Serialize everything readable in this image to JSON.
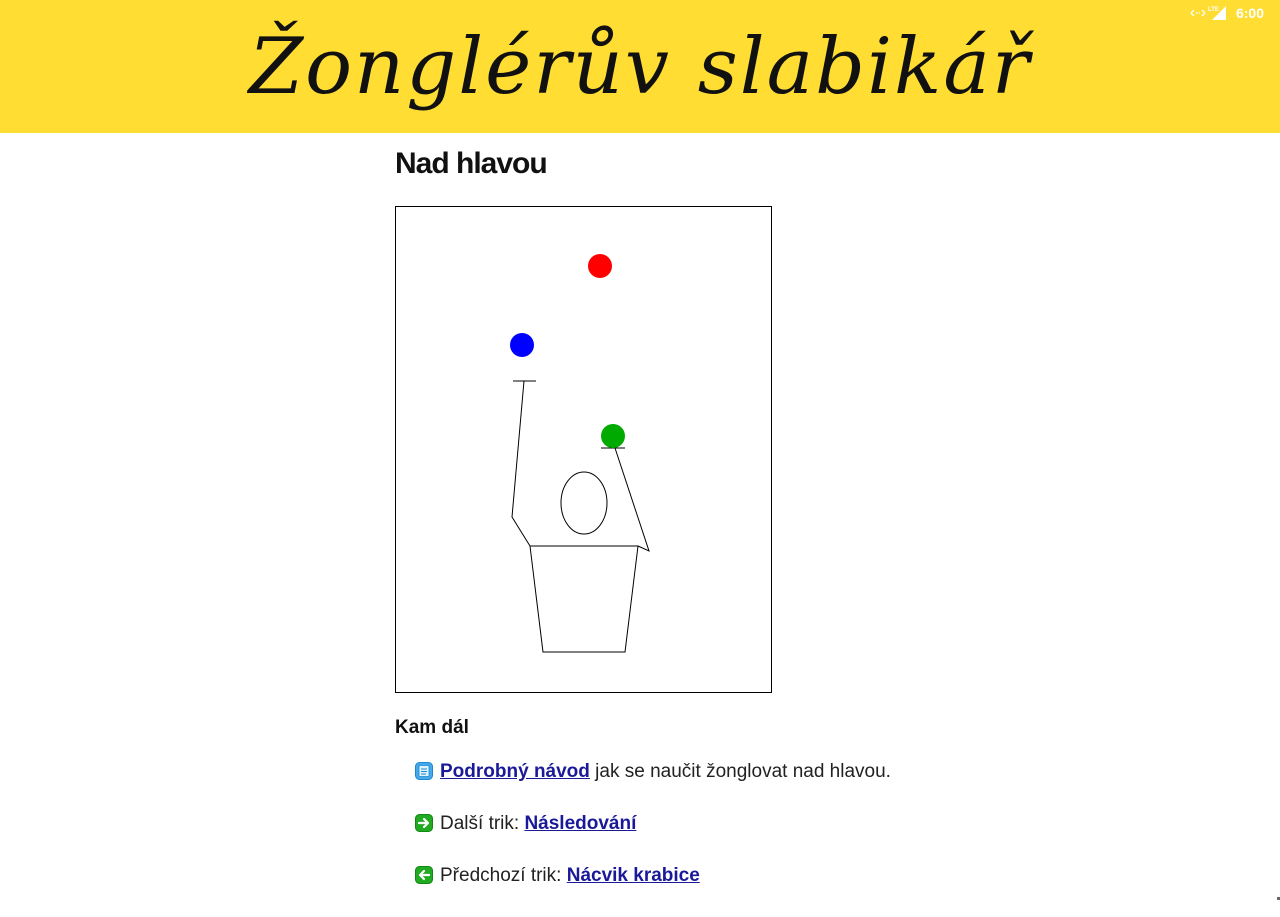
{
  "status_bar": {
    "time": "6:00",
    "icons": [
      "data-sync-icon",
      "lte-signal-icon"
    ],
    "color": "#ffffff"
  },
  "header": {
    "site_title": "Žonglérův slabikář",
    "background": "#ffdd33"
  },
  "page": {
    "title": "Nad hlavou"
  },
  "figure": {
    "balls": [
      {
        "name": "red-ball",
        "color": "#ff0000"
      },
      {
        "name": "blue-ball",
        "color": "#0000ff"
      },
      {
        "name": "green-ball",
        "color": "#00aa00"
      }
    ]
  },
  "next_steps": {
    "heading": "Kam dál",
    "items": [
      {
        "icon": "document-icon",
        "link_text": "Podrobný návod",
        "prefix": "",
        "suffix": " jak se naučit žonglovat nad hlavou."
      },
      {
        "icon": "arrow-right-icon",
        "prefix": "Další trik: ",
        "link_text": "Následování",
        "suffix": ""
      },
      {
        "icon": "arrow-left-icon",
        "prefix": "Předchozí trik: ",
        "link_text": "Nácvik krabice",
        "suffix": ""
      }
    ]
  },
  "colors": {
    "link": "#1a1a99",
    "accent_yellow": "#ffdd33",
    "icon_green": "#22aa22",
    "icon_blue": "#44aaee"
  }
}
